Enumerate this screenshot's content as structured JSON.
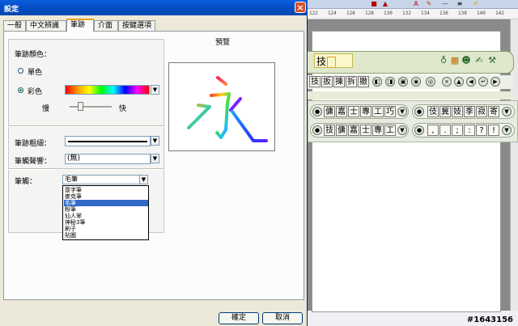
{
  "dialog": {
    "title": "設定",
    "close_glyph": "×",
    "tabs": [
      {
        "label": "一般"
      },
      {
        "label": "中文辨識"
      },
      {
        "label": "筆跡"
      },
      {
        "label": "介面"
      },
      {
        "label": "按鍵選項"
      }
    ],
    "active_tab": "筆跡",
    "stroke_color_label": "筆跡顏色：",
    "mono_label": "單色",
    "color_label": "彩色",
    "color_mode": "彩色",
    "speed_slow": "慢",
    "speed_fast": "快",
    "speed_level": 0.25,
    "thickness_label": "筆跡粗細：",
    "effect_label": "筆觸聲響：",
    "effect_value": "(無)",
    "brush_label": "筆觸：",
    "brush_value": "毛筆",
    "brush_options": [
      "簽字筆",
      "麥克筆",
      "毛筆",
      "粉筆",
      "仙人掌",
      "神秘3筆",
      "刷子",
      "貼圖"
    ],
    "selected_brush_index": 2,
    "preview_label": "預覽",
    "preview_char": "永",
    "ok_label": "確定",
    "cancel_label": "取消",
    "dropdown_glyph": "▼"
  },
  "background": {
    "ruler_ticks": [
      "122",
      "124",
      "126",
      "128",
      "130",
      "132",
      "134",
      "136",
      "138",
      "140",
      "142"
    ],
    "ime_input_text": "技",
    "row2_keys": [
      "技",
      "扳",
      "揀",
      "拆",
      "撤"
    ],
    "panel_row1_left": [
      "傭",
      "嘉",
      "士",
      "專",
      "工",
      "巧"
    ],
    "panel_row1_right": [
      "伎",
      "冀",
      "妓",
      "季",
      "寂",
      "寄"
    ],
    "panel_row2_left": [
      "技",
      "傭",
      "嘉",
      "士",
      "專",
      "工"
    ],
    "panel_row2_right": [
      ",",
      ".",
      ";",
      ":",
      "?",
      "!"
    ]
  },
  "watermark": "#1643156",
  "colors": {
    "title_bar": "#0450c8",
    "dialog_bg": "#ece9d8",
    "selection": "#316ac5"
  }
}
